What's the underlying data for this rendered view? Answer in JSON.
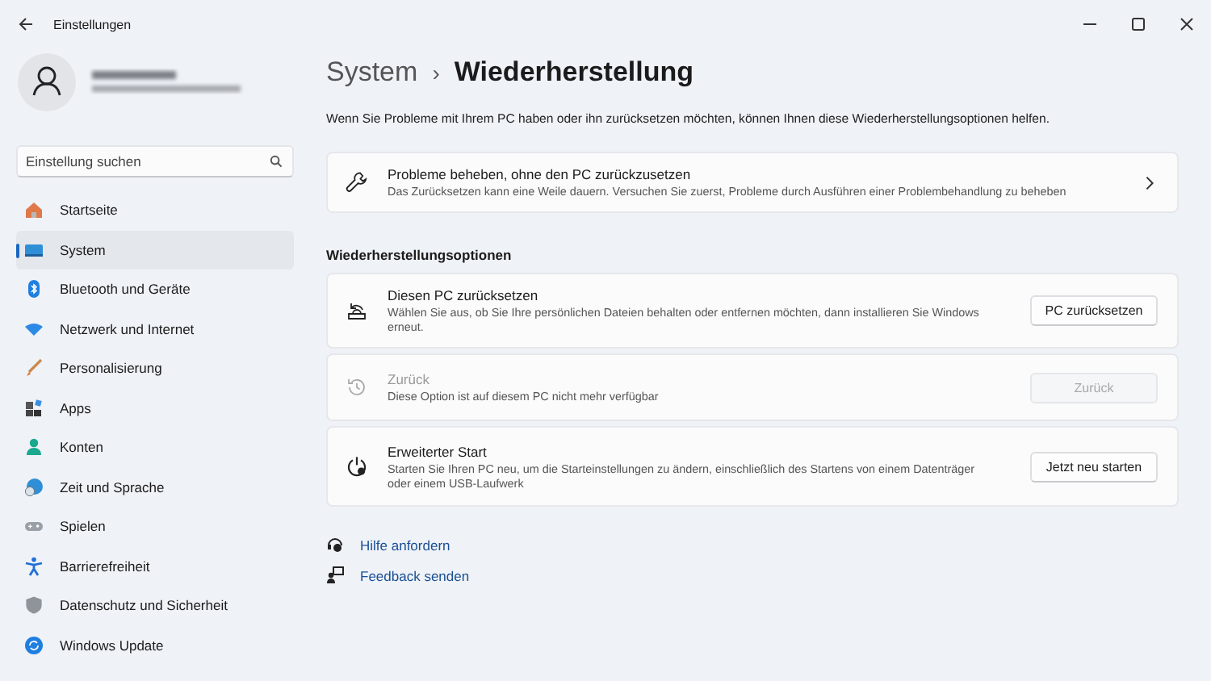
{
  "window": {
    "title": "Einstellungen"
  },
  "search": {
    "placeholder": "Einstellung suchen"
  },
  "nav": [
    {
      "label": "Startseite",
      "selected": false
    },
    {
      "label": "System",
      "selected": true
    },
    {
      "label": "Bluetooth und Geräte",
      "selected": false
    },
    {
      "label": "Netzwerk und Internet",
      "selected": false
    },
    {
      "label": "Personalisierung",
      "selected": false
    },
    {
      "label": "Apps",
      "selected": false
    },
    {
      "label": "Konten",
      "selected": false
    },
    {
      "label": "Zeit und Sprache",
      "selected": false
    },
    {
      "label": "Spielen",
      "selected": false
    },
    {
      "label": "Barrierefreiheit",
      "selected": false
    },
    {
      "label": "Datenschutz und Sicherheit",
      "selected": false
    },
    {
      "label": "Windows Update",
      "selected": false
    }
  ],
  "breadcrumb": {
    "parent": "System",
    "separator": "›",
    "current": "Wiederherstellung"
  },
  "description": "Wenn Sie Probleme mit Ihrem PC haben oder ihn zurücksetzen möchten, können Ihnen diese Wiederherstellungsoptionen helfen.",
  "troubleshoot": {
    "title": "Probleme beheben, ohne den PC zurückzusetzen",
    "subtitle": "Das Zurücksetzen kann eine Weile dauern. Versuchen Sie zuerst, Probleme durch Ausführen einer Problembehandlung zu beheben"
  },
  "section_title": "Wiederherstellungsoptionen",
  "options": [
    {
      "title": "Diesen PC zurücksetzen",
      "subtitle": "Wählen Sie aus, ob Sie Ihre persönlichen Dateien behalten oder entfernen möchten, dann installieren Sie Windows erneut.",
      "button": "PC zurücksetzen",
      "disabled": false
    },
    {
      "title": "Zurück",
      "subtitle": "Diese Option ist auf diesem PC nicht mehr verfügbar",
      "button": "Zurück",
      "disabled": true
    },
    {
      "title": "Erweiterter Start",
      "subtitle": "Starten Sie Ihren PC neu, um die Starteinstellungen zu ändern, einschließlich des Startens von einem Datenträger oder einem USB-Laufwerk",
      "button": "Jetzt neu starten",
      "disabled": false
    }
  ],
  "links": [
    "Hilfe anfordern",
    "Feedback senden"
  ]
}
